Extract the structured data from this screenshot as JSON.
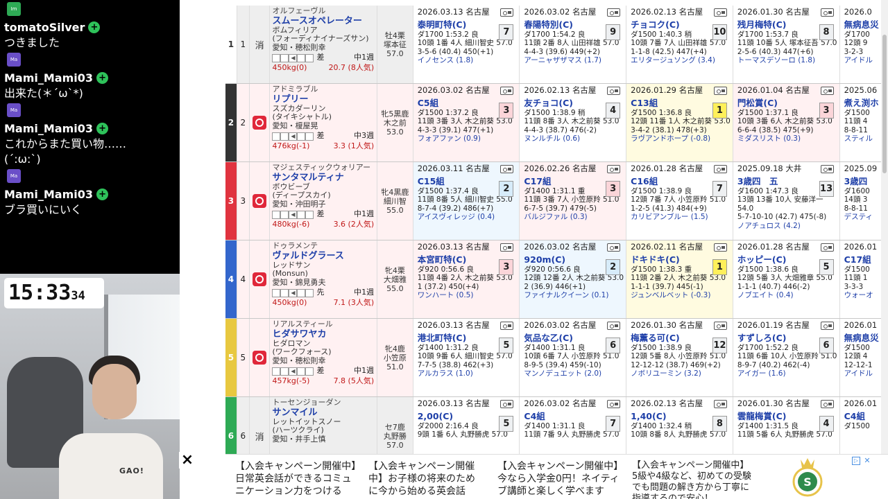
{
  "chat": {
    "messages": [
      {
        "icon": "Im",
        "user": "tomatoSilver",
        "text": "つきました"
      },
      {
        "icon": "Ma",
        "user": "Mami_Mami03",
        "text": "出来た(＊´ω`*)"
      },
      {
        "icon": "Ma",
        "user": "Mami_Mami03",
        "text": "これからまた買い物……\n(´:ω:`)"
      },
      {
        "icon": "Ma",
        "user": "Mami_Mami03",
        "text": "ブラ買いにいく"
      }
    ]
  },
  "clock": {
    "time": "15:33",
    "seconds": "34"
  },
  "webcam": {
    "shirt_text": "GAO!"
  },
  "entries": [
    {
      "frame": "1",
      "frame_color": "#ffffff",
      "frame_text_color": "#333333",
      "num": "1",
      "mark": "消",
      "sire": "オルフェーヴル",
      "name": "スムースオペレーター",
      "dam": "ボムフィリア",
      "damsire": "(フォーディナイナーズサン)",
      "owner": "愛知・穂松則幸",
      "style": "差",
      "rot": "中1週",
      "weight": "450kg(0)",
      "odds": "20.7 (8人気)",
      "jockey": [
        "牡4栗",
        "塚本征",
        "57.0"
      ],
      "row_bg": "#eeeeee",
      "races": [
        {
          "date": "2026.03.13",
          "venue": "名古屋",
          "name": "泰明町特(C)",
          "pos": "7",
          "pc": "",
          "course": "ダ1700 1:53.2 良",
          "detail": "10頭 1番 4人 細川智史 57.0",
          "pass": "3-5-6 (40.4) 450(+1)",
          "winner": "イノセンス (1.8)"
        },
        {
          "date": "2026.03.02",
          "venue": "名古屋",
          "name": "春陽特別(C)",
          "pos": "9",
          "pc": "",
          "course": "ダ1700 1:54.2 良",
          "detail": "11頭 2番 8人 山田祥雄 57.0",
          "pass": "4-4-3 (39.6) 449(+2)",
          "winner": "アーニャザザマス (1.7)"
        },
        {
          "date": "2026.02.13",
          "venue": "名古屋",
          "name": "チョコク(C)",
          "pos": "10",
          "pc": "",
          "course": "ダ1500 1:40.3 稍",
          "detail": "10頭 7番 7人 山田祥雄 57.0",
          "pass": "1-1-8 (42.5) 447(+4)",
          "winner": "エリタージュソング (3.4)"
        },
        {
          "date": "2026.01.30",
          "venue": "名古屋",
          "name": "残月梅特(C)",
          "pos": "8",
          "pc": "",
          "course": "ダ1700 1:53.7 良",
          "detail": "11頭 10番 5人 塚本征吾 57.0",
          "pass": "2-5-6 (40.3) 447(+6)",
          "winner": "トーマスデソーロ (1.8)"
        },
        {
          "date": "2026.0",
          "venue": "",
          "name": "無病息災",
          "pos": "",
          "pc": "",
          "course": "ダ1700",
          "detail": "12頭 9",
          "pass": "3-2-3",
          "winner": "アイドル"
        }
      ]
    },
    {
      "frame": "2",
      "frame_color": "#333333",
      "frame_text_color": "#ffffff",
      "num": "2",
      "mark": "",
      "sire": "アドミラブル",
      "name": "リプリー",
      "dam": "スズカダーリン",
      "damsire": "(タイキシャトル)",
      "owner": "愛知・榎屋晃",
      "style": "差",
      "rot": "中3週",
      "weight": "476kg(-1)",
      "odds": "3.3 (1人気)",
      "jockey": [
        "牝5黒鹿",
        "木之前",
        "53.0"
      ],
      "row_bg": "#fff1f2",
      "races": [
        {
          "date": "2026.03.02",
          "venue": "名古屋",
          "name": "C5組",
          "pos": "3",
          "pc": "p3",
          "course": "ダ1500 1:37.2 良",
          "detail": "11頭 3番 3人 木之前葵 53.0",
          "pass": "4-3-3 (39.1) 477(+1)",
          "winner": "フォアファン (0.9)"
        },
        {
          "date": "2026.02.13",
          "venue": "名古屋",
          "name": "友チョコ(C)",
          "pos": "4",
          "pc": "",
          "course": "ダ1500 1:38.9 稍",
          "detail": "11頭 8番 3人 木之前葵 53.0",
          "pass": "4-4-3 (38.7) 476(-2)",
          "winner": "ヌンルチル (0.6)"
        },
        {
          "date": "2026.01.29",
          "venue": "名古屋",
          "name": "C13組",
          "pos": "1",
          "pc": "p1",
          "course": "ダ1500 1:36.8 良",
          "detail": "12頭 11番 1人 木之前葵 53.0",
          "pass": "3-4-2 (38.1) 478(+3)",
          "winner": "ラヴアンドホープ (-0.8)"
        },
        {
          "date": "2026.01.04",
          "venue": "名古屋",
          "name": "門松賞(C)",
          "pos": "3",
          "pc": "p3",
          "course": "ダ1500 1:37.1 良",
          "detail": "10頭 3番 6人 木之前葵 53.0",
          "pass": "6-6-4 (38.5) 475(+9)",
          "winner": "ミダスリスト (0.3)"
        },
        {
          "date": "2025.06",
          "venue": "",
          "name": "煮え渕ホ",
          "pos": "",
          "pc": "",
          "course": "ダ1500",
          "detail": "11頭 4",
          "pass": "8-8-11",
          "winner": "スティル"
        }
      ]
    },
    {
      "frame": "3",
      "frame_color": "#e0333f",
      "frame_text_color": "#ffffff",
      "num": "3",
      "mark": "",
      "sire": "マジェスティックウォリアー",
      "name": "サンタマルティナ",
      "dam": "ボウビーブ",
      "damsire": "(ディープスカイ)",
      "owner": "愛知・沖田明子",
      "style": "差",
      "rot": "中1週",
      "weight": "480kg(-6)",
      "odds": "3.6 (2人気)",
      "jockey": [
        "牝4黒鹿",
        "細川智",
        "55.0"
      ],
      "row_bg": "#fff1f2",
      "races": [
        {
          "date": "2026.03.11",
          "venue": "名古屋",
          "name": "C15組",
          "pos": "2",
          "pc": "p2",
          "course": "ダ1500 1:37.4 良",
          "detail": "11頭 8番 5人 細川智史 55.0",
          "pass": "8-7-4 (39.2) 486(+7)",
          "winner": "アイスヴィレッジ (0.4)"
        },
        {
          "date": "2026.02.26",
          "venue": "名古屋",
          "name": "C17組",
          "pos": "3",
          "pc": "p3",
          "course": "ダ1400 1:31.1 重",
          "detail": "11頭 3番 7人 小笠原羚 51.0",
          "pass": "6-7-5 (39.7) 479(-5)",
          "winner": "バルジファル (0.3)"
        },
        {
          "date": "2026.01.28",
          "venue": "名古屋",
          "name": "C16組",
          "pos": "7",
          "pc": "",
          "course": "ダ1500 1:38.9 良",
          "detail": "12頭 7番 7人 小笠原羚 51.0",
          "pass": "1-2-5 (41.3) 484(+9)",
          "winner": "カリビアンブルー (1.5)"
        },
        {
          "date": "2025.09.18",
          "venue": "大井",
          "name": "3歳四　五",
          "pos": "13",
          "pc": "",
          "course": "ダ1600 1:47.3 良",
          "detail": "13頭 13番 10人 安藤洋一 54.0",
          "pass": "5-7-10-10 (42.7) 475(-8)",
          "winner": "ノアチュロス (4.2)"
        },
        {
          "date": "2025.09",
          "venue": "",
          "name": "3歳四",
          "pos": "",
          "pc": "",
          "course": "ダ1600",
          "detail": "14頭 3",
          "pass": "8-8-11",
          "winner": "デスティ"
        }
      ]
    },
    {
      "frame": "4",
      "frame_color": "#3366cc",
      "frame_text_color": "#ffffff",
      "num": "4",
      "mark": "",
      "sire": "ドゥラメンテ",
      "name": "ヴァルドグラース",
      "dam": "レッドサン",
      "damsire": "(Monsun)",
      "owner": "愛知・錦見勇夫",
      "style": "先",
      "rot": "中1週",
      "weight": "450kg(0)",
      "odds": "7.1 (3人気)",
      "jockey": [
        "牝4栗",
        "大畑雅",
        "55.0"
      ],
      "row_bg": "#fff1f2",
      "races": [
        {
          "date": "2026.03.13",
          "venue": "名古屋",
          "name": "本宮町特(C)",
          "pos": "3",
          "pc": "p3",
          "course": "ダ920 0:56.6 良",
          "detail": "11頭 4番 2人 木之前葵 53.0",
          "pass": "1 (37.2) 450(+4)",
          "winner": "ワンハート (0.5)"
        },
        {
          "date": "2026.03.02",
          "venue": "名古屋",
          "name": "920m(C)",
          "pos": "2",
          "pc": "p2",
          "course": "ダ920 0:56.6 良",
          "detail": "12頭 12番 2人 木之前葵 53.0",
          "pass": "2 (36.9) 446(+1)",
          "winner": "ファイナルクイーン (0.1)"
        },
        {
          "date": "2026.02.11",
          "venue": "名古屋",
          "name": "ドキドキ(C)",
          "pos": "1",
          "pc": "p1",
          "course": "ダ1500 1:38.3 重",
          "detail": "11頭 2番 2人 木之前葵 53.0",
          "pass": "1-1-1 (39.7) 445(-1)",
          "winner": "ジュンベルベット (-0.3)"
        },
        {
          "date": "2026.01.28",
          "venue": "名古屋",
          "name": "ホッピー(C)",
          "pos": "5",
          "pc": "",
          "course": "ダ1500 1:38.6 良",
          "detail": "12頭 5番 3人 大畑雅章 55.0",
          "pass": "1-1-1 (40.7) 446(-2)",
          "winner": "ノブエイト (0.4)"
        },
        {
          "date": "2026.01",
          "venue": "",
          "name": "C17組",
          "pos": "",
          "pc": "",
          "course": "ダ1500",
          "detail": "11頭 1",
          "pass": "3-3-3",
          "winner": "ウォーオ"
        }
      ]
    },
    {
      "frame": "5",
      "frame_color": "#e8c840",
      "frame_text_color": "#ffffff",
      "num": "5",
      "mark": "",
      "sire": "リアルスティール",
      "name": "ヒダサワヤカ",
      "dam": "ヒダロマン",
      "damsire": "(ワークフォース)",
      "owner": "愛知・穂松則幸",
      "style": "差",
      "rot": "中1週",
      "weight": "457kg(-5)",
      "odds": "7.8 (5人気)",
      "jockey": [
        "牝4鹿",
        "小笠原",
        "51.0"
      ],
      "row_bg": "#fff1f2",
      "races": [
        {
          "date": "2026.03.13",
          "venue": "名古屋",
          "name": "港北町特(C)",
          "pos": "5",
          "pc": "",
          "course": "ダ1400 1:31.2 良",
          "detail": "10頭 9番 6人 細川智史 57.0",
          "pass": "7-7-5 (38.8) 462(+3)",
          "winner": "アルカラス (1.0)"
        },
        {
          "date": "2026.03.02",
          "venue": "名古屋",
          "name": "気品な乙(C)",
          "pos": "6",
          "pc": "",
          "course": "ダ1400 1:31.1 良",
          "detail": "10頭 6番 7人 小笠原羚 51.0",
          "pass": "8-9-5 (39.4) 459(-10)",
          "winner": "マンノデュエット (2.0)"
        },
        {
          "date": "2026.01.30",
          "venue": "名古屋",
          "name": "梅薫る可(C)",
          "pos": "12",
          "pc": "",
          "course": "ダ1500 1:38.9 良",
          "detail": "12頭 5番 8人 小笠原羚 51.0",
          "pass": "12-12-12 (38.7) 469(+2)",
          "winner": "ノボリユーミン (3.2)"
        },
        {
          "date": "2026.01.19",
          "venue": "名古屋",
          "name": "すずしろ(C)",
          "pos": "6",
          "pc": "",
          "course": "ダ1700 1:52.2 良",
          "detail": "11頭 6番 10人 小笠原羚 51.0",
          "pass": "8-9-7 (40.2) 462(-4)",
          "winner": "アイガー (1.6)"
        },
        {
          "date": "2026.01",
          "venue": "",
          "name": "無病息災",
          "pos": "",
          "pc": "",
          "course": "ダ1500",
          "detail": "12頭 4",
          "pass": "12-12-1",
          "winner": "アイドル"
        }
      ]
    },
    {
      "frame": "6",
      "frame_color": "#2eaa55",
      "frame_text_color": "#ffffff",
      "num": "6",
      "mark": "消",
      "sire": "トーセンジョーダン",
      "name": "サンマイル",
      "dam": "レットイットスノー",
      "damsire": "(ハーツクライ)",
      "owner": "愛知・井手上慎",
      "style": "",
      "rot": "",
      "weight": "",
      "odds": "",
      "jockey": [
        "セ7鹿",
        "丸野勝",
        "57.0"
      ],
      "row_bg": "#eeeeee",
      "races": [
        {
          "date": "2026.03.13",
          "venue": "名古屋",
          "name": "2,00(C)",
          "pos": "5",
          "pc": "",
          "course": "ダ2000 2:16.4 良",
          "detail": "9頭 1番 6人 丸野勝虎 57.0",
          "pass": "",
          "winner": ""
        },
        {
          "date": "2026.03.02",
          "venue": "名古屋",
          "name": "C4組",
          "pos": "7",
          "pc": "",
          "course": "ダ1400 1:31.1 良",
          "detail": "11頭 7番 9人 丸野勝虎 57.0",
          "pass": "",
          "winner": ""
        },
        {
          "date": "2026.02.13",
          "venue": "名古屋",
          "name": "1,40(C)",
          "pos": "8",
          "pc": "",
          "course": "ダ1400 1:32.4 稍",
          "detail": "10頭 8番 8人 丸野勝虎 57.0",
          "pass": "",
          "winner": ""
        },
        {
          "date": "2026.01.30",
          "venue": "名古屋",
          "name": "雲龍梅賞(C)",
          "pos": "4",
          "pc": "",
          "course": "ダ1400 1:31.5 良",
          "detail": "11頭 5番 6人 丸野勝虎 57.0",
          "pass": "",
          "winner": ""
        },
        {
          "date": "2026.01",
          "venue": "",
          "name": "C4組",
          "pos": "",
          "pc": "",
          "course": "ダ1500",
          "detail": "",
          "pass": "",
          "winner": ""
        }
      ]
    }
  ],
  "ads": {
    "items": [
      "【入会キャンペーン開催中】\n日常英会話ができるコミュ\nニケーション力をつける",
      "【入会キャンペーン開催\n中】お子様の将来のため\nに今から始める英会話",
      "【入会キャンペーン開催中】\n今なら入学金0円！ネイティ\nブ講師と楽しく学べます",
      "【入会キャンペーン開催中】\n5級や4級など、初めての受験\nでも問題の解き方から丁寧に\n指導するので安心！"
    ],
    "close_label": "✕"
  }
}
